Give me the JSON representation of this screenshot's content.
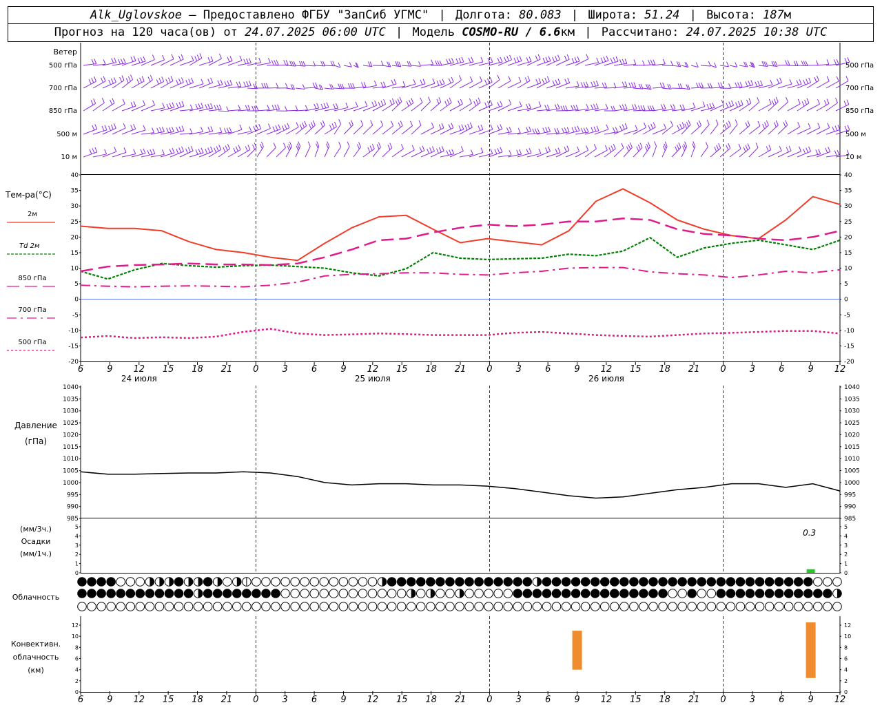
{
  "header": {
    "station": "Alk_Uglovskoe",
    "provider": "— Предоставлено ФГБУ \"ЗапСиб УГМС\"",
    "lon_label": "Долгота:",
    "lon": "80.083",
    "lat_label": "Широта:",
    "lat": "51.24",
    "alt_label": "Высота:",
    "alt": "187",
    "alt_unit": "м",
    "forecast_label": "Прогноз на 120 часа(ов) от",
    "forecast_from": "24.07.2025 06:00 UTC",
    "model_label": "Модель",
    "model": "COSMO-RU / 6.6",
    "model_unit": "км",
    "calc_label": "Рассчитано:",
    "calc_time": "24.07.2025 10:38 UTC"
  },
  "labels": {
    "wind": "Ветер",
    "wind_levels": [
      "500 гПа",
      "700 гПа",
      "850 гПа",
      "500 м",
      "10  м"
    ],
    "temp_title": "Тем-ра(°С)",
    "temp_legend": [
      "2м",
      "Td  2м",
      "850 гПа",
      "700 гПа",
      "500 гПа"
    ],
    "pressure_title": "Давление",
    "pressure_unit": "(гПа)",
    "precip_1": "(мм/3ч.)",
    "precip_2": "Осадки",
    "precip_3": "(мм/1ч.)",
    "precip_value": "0.3",
    "cloud": "Облачность",
    "conv_1": "Конвективн.",
    "conv_2": "облачность",
    "conv_3": "(км)"
  },
  "colors": {
    "t2m": "#f03c28",
    "td2m": "#008000",
    "t850": "#e01a8c",
    "t700": "#e01a8c",
    "t500": "#e01a8c",
    "wind": "#8a2be2",
    "zero_line": "#4060ff",
    "precip": "#22cc22",
    "convective": "#f08c30"
  },
  "time_axis": {
    "hour_labels": [
      "6",
      "9",
      "12",
      "15",
      "18",
      "21",
      "0",
      "3",
      "6",
      "9",
      "12",
      "15",
      "18",
      "21",
      "0",
      "3",
      "6",
      "9",
      "12",
      "15",
      "18",
      "21",
      "0",
      "3",
      "6",
      "9",
      "12"
    ],
    "day_labels": [
      "24 июля",
      "25 июля",
      "26 июля"
    ]
  },
  "chart_data": [
    {
      "type": "line",
      "title": "Тем-ра(°С)",
      "ylim": [
        -20,
        40
      ],
      "yticks": [
        "40",
        "35",
        "30",
        "25",
        "20",
        "15",
        "10",
        "5",
        "0",
        "-5",
        "-10",
        "-15",
        "-20"
      ],
      "x_hours": [
        0,
        3,
        6,
        9,
        12,
        15,
        18,
        21,
        24,
        27,
        30,
        33,
        36,
        39,
        42,
        45,
        48,
        51,
        54,
        57,
        60,
        63,
        66,
        69,
        72,
        75,
        78
      ],
      "series": [
        {
          "name": "2м",
          "values": [
            23.5,
            22.8,
            22.8,
            22,
            18.5,
            16,
            15,
            13.5,
            12.5,
            18,
            23,
            26.5,
            27,
            22.5,
            18.2,
            19.5,
            18.5,
            17.5,
            22,
            31.5,
            35.5,
            31,
            25.5,
            22.5,
            20.5,
            19.5,
            25.5,
            33,
            30.5
          ]
        },
        {
          "name": "Td  2м",
          "values": [
            9,
            6.5,
            9.5,
            11.5,
            10.8,
            10.3,
            10.8,
            11,
            10.5,
            10,
            8.5,
            7.5,
            9.8,
            15,
            13.2,
            12.8,
            13,
            13.2,
            14.5,
            14,
            15.5,
            19.8,
            13.5,
            16.5,
            18,
            19,
            17.5,
            16,
            19
          ]
        },
        {
          "name": "850 гПа",
          "values": [
            9,
            10.5,
            11,
            11.2,
            11.5,
            11.2,
            11.2,
            11,
            11.5,
            13.5,
            16,
            19,
            19.5,
            21.5,
            23,
            24,
            23.5,
            24,
            25,
            25,
            26,
            25.5,
            22.5,
            21,
            20.5,
            19.5,
            19,
            20,
            22
          ]
        },
        {
          "name": "700 гПа",
          "values": [
            4.5,
            4.2,
            4,
            4.2,
            4.3,
            4.2,
            4,
            4.5,
            5.5,
            7.5,
            8,
            8.2,
            8.5,
            8.5,
            8,
            7.8,
            8.5,
            9,
            10,
            10.2,
            10.2,
            8.8,
            8.2,
            7.8,
            7,
            7.8,
            9,
            8.5,
            9.5
          ]
        },
        {
          "name": "500 гПа",
          "values": [
            -12.3,
            -11.8,
            -12.5,
            -12.2,
            -12.5,
            -12,
            -10.5,
            -9.5,
            -11,
            -11.5,
            -11.3,
            -11,
            -11.2,
            -11.5,
            -11.5,
            -11.5,
            -10.8,
            -10.5,
            -11,
            -11.5,
            -11.8,
            -12,
            -11.5,
            -11,
            -10.8,
            -10.5,
            -10.2,
            -10.2,
            -11
          ]
        }
      ]
    },
    {
      "type": "line",
      "title": "Давление",
      "ylabel": "(гПа)",
      "ylim": [
        985,
        1040
      ],
      "yticks": [
        "1040",
        "1035",
        "1030",
        "1025",
        "1020",
        "1015",
        "1010",
        "1005",
        "1000",
        "995",
        "990",
        "985"
      ],
      "x_hours": [
        0,
        3,
        6,
        9,
        12,
        15,
        18,
        21,
        24,
        27,
        30,
        33,
        36,
        39,
        42,
        45,
        48,
        51,
        54,
        57,
        60,
        63,
        66,
        69,
        72,
        75,
        78
      ],
      "values": [
        1004.5,
        1003.5,
        1003.5,
        1003.8,
        1004,
        1004,
        1004.5,
        1004,
        1002.5,
        1000,
        999,
        999.5,
        999.5,
        999,
        999,
        998.5,
        997.5,
        996,
        994.5,
        993.5,
        994,
        995.5,
        997,
        998,
        999.5,
        999.5,
        998,
        999.5,
        996.5
      ]
    },
    {
      "type": "bar",
      "title": "Осадки",
      "ylabel": "(мм/3ч.) (мм/1ч.)",
      "ylim": [
        0,
        5
      ],
      "yticks": [
        "5",
        "4",
        "3",
        "2",
        "1",
        "0"
      ],
      "bars": [
        {
          "hour": 75,
          "value": 0.3,
          "label": "0.3"
        }
      ]
    },
    {
      "type": "bar",
      "title": "Конвективн. облачность (км)",
      "ylim": [
        0,
        13
      ],
      "yticks": [
        "12",
        "10",
        "8",
        "6",
        "4",
        "2",
        "0"
      ],
      "bars": [
        {
          "hour": 51,
          "bottom_km": 4,
          "top_km": 11
        },
        {
          "hour": 75,
          "bottom_km": 2.5,
          "top_km": 12.5
        }
      ]
    }
  ],
  "cloud_rows": {
    "upper": "FFFFOOOHHHFHHFHOHIOOOOOOOOOOOOOHFFFFFFFFFFFFFFFHFFFFFFFFFFFFFFFFFFFFFFFFFFFFOOOOOHOOOOOOOOOOOOOOOOOOOOOOOOOOOOOOOOOOOFFFFFFFFFFFFF",
    "middle": "FFFFFFFFFFFFHFFFFFFFFOOOOOOOOOOOOOHOHOOHOOOOOFFFFFFFFFFFFFFFFOOFOOFFFFFFFFFFFFHOFOOOOOOOOOOOOOOOOOOOOOOOOOOOOOOOOOOOOOOOFFFFFFFFFFFF",
    "lower": "OOOOOOOOOOOOOOOOOOOOOOOOOOOOOOOOOOOOOOOOOOOOOOOOOOOOOOOOOOOOOOOOOOOOOOOOOOOOOOOOOOOOOOOOOOOOOOOOOOOOOOOOOOOOOOOOOOOOOOOOOOOOO"
  }
}
